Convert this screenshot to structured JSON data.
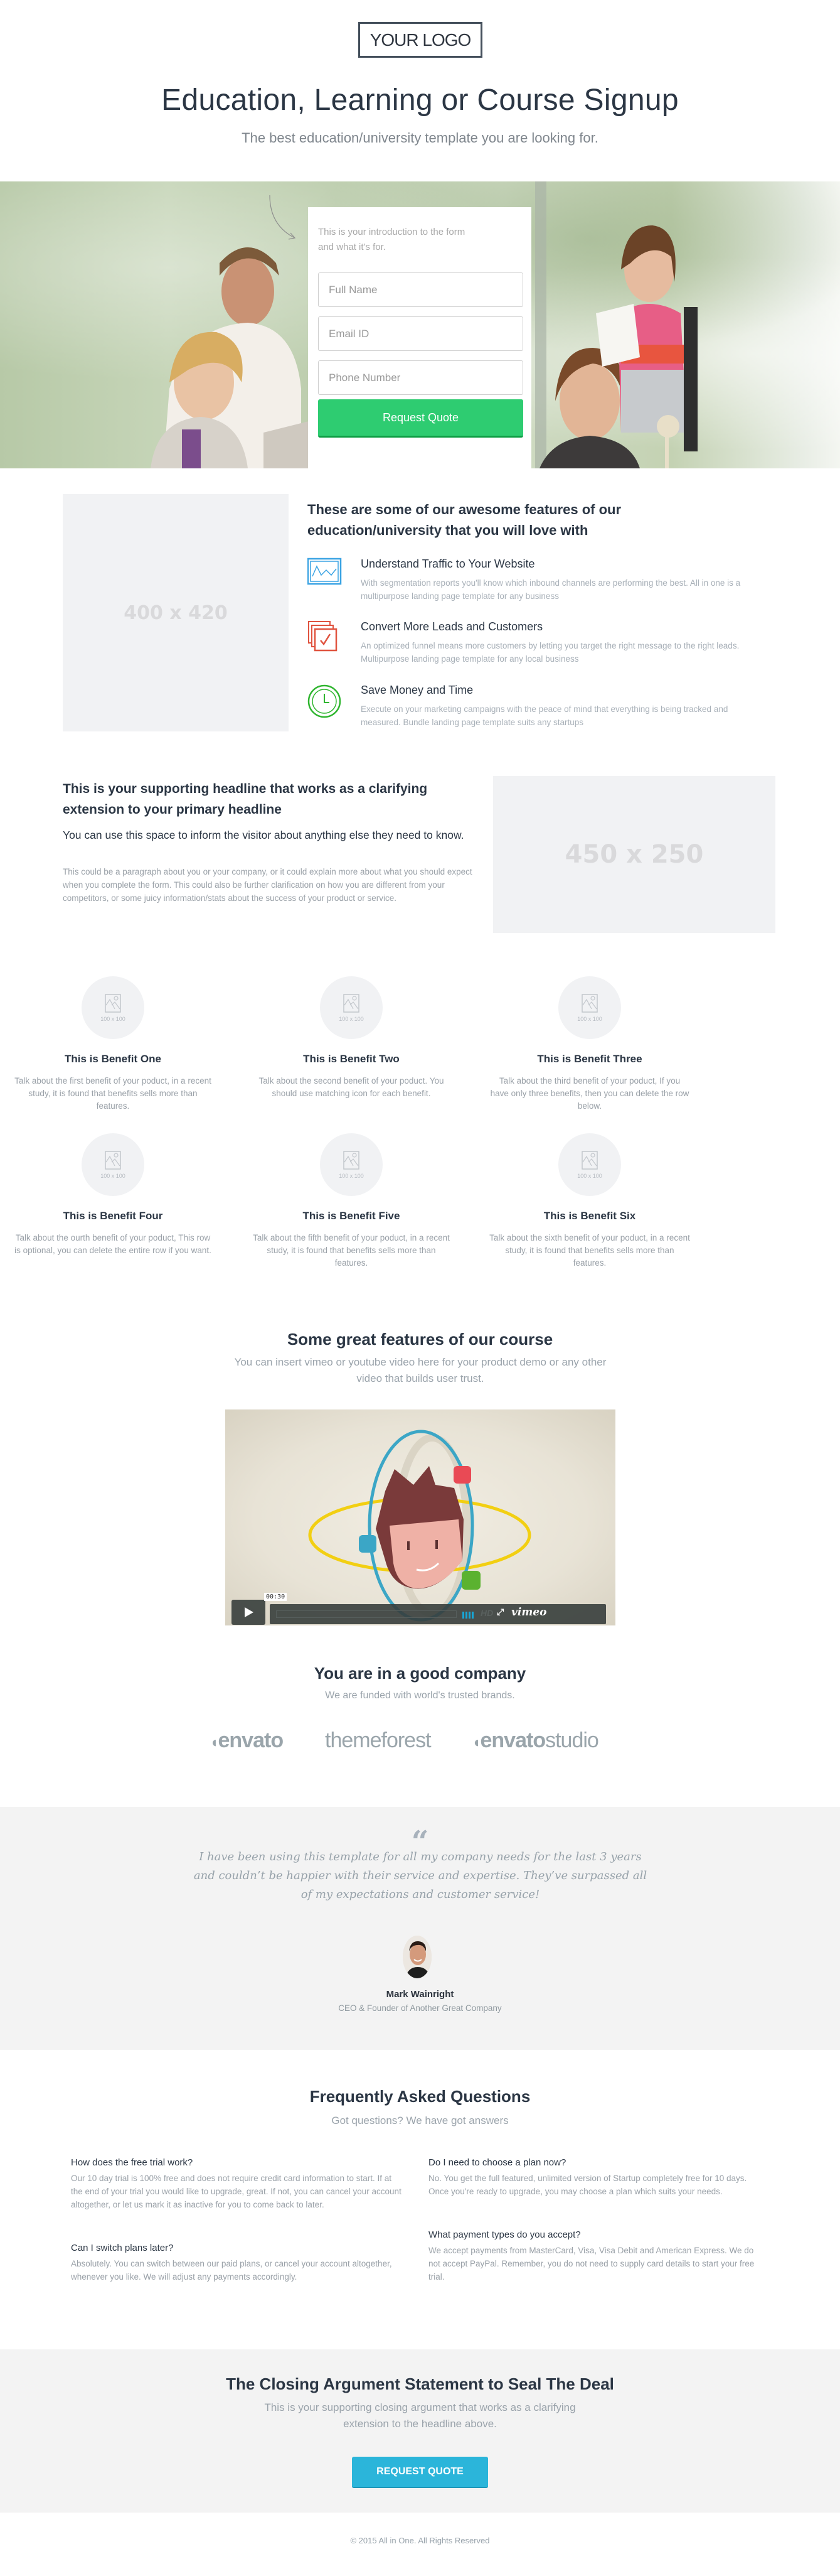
{
  "header": {
    "logo": "YOUR LOGO",
    "title": "Education, Learning or Course Signup",
    "subtitle": "The best education/university template you are looking for."
  },
  "hero_form": {
    "intro": "This is your introduction to the form and what it's for.",
    "fields": [
      {
        "placeholder": "Full Name",
        "value": ""
      },
      {
        "placeholder": "Email ID",
        "value": ""
      },
      {
        "placeholder": "Phone Number",
        "value": ""
      }
    ],
    "submit_label": "Request Quote",
    "colors": {
      "button": "#2ecc71"
    }
  },
  "features": {
    "image_placeholder": "400 x 420",
    "title": "These are some of our awesome features of our education/university that you will love with",
    "items": [
      {
        "icon": "chart-icon",
        "title": "Understand Traffic to Your Website",
        "description": "With segmentation reports you'll know which inbound channels are performing the best. All in one is a multipurpose landing page template for any business",
        "color": "#3aa3e3"
      },
      {
        "icon": "documents-check-icon",
        "title": "Convert More Leads and Customers",
        "description": "An optimized funnel means more customers by letting you target the right message to the right leads. Multipurpose landing page template for any local business",
        "color": "#e0533f"
      },
      {
        "icon": "clock-icon",
        "title": "Save Money and Time",
        "description": "Execute on your marketing campaigns with the peace of mind that everything is being tracked and measured. Bundle landing page template suits any startups",
        "color": "#2fb52f"
      }
    ]
  },
  "supporting": {
    "headline": "This is your supporting headline that works as a clarifying extension to your primary headline",
    "subheadline": "You can use this space to inform the visitor about anything else they need to know.",
    "body": "This could be a paragraph about you or your company, or it could explain more about what you should expect when you complete the form. This could also be further clarification on how you are different from your competitors, or some juicy information/stats about the success of your product or service.",
    "image_placeholder": "450 x 250"
  },
  "benefits": {
    "image_label": "100 x 100",
    "items": [
      {
        "title": "This is Benefit One",
        "description": "Talk about the first benefit of your poduct, in a recent study, it is found that benefits sells more than features."
      },
      {
        "title": "This is Benefit Two",
        "description": "Talk about the second benefit of your poduct. You should use matching icon for each benefit."
      },
      {
        "title": "This is Benefit Three",
        "description": "Talk about the third benefit of your poduct, If you have only three benefits, then you can delete the row below."
      },
      {
        "title": "This is Benefit Four",
        "description": "Talk about the ourth benefit of your poduct, This row is optional, you can delete the entire row if you want."
      },
      {
        "title": "This is Benefit Five",
        "description": "Talk about the fifth benefit of your poduct, in a recent study, it is found that benefits sells more than features."
      },
      {
        "title": "This is Benefit Six",
        "description": "Talk about the sixth benefit of your poduct, in a recent study, it is found that benefits sells more than features."
      }
    ]
  },
  "video": {
    "title": "Some great features of our course",
    "subtitle": "You can insert vimeo or youtube video here for your product demo or any other video that builds user trust.",
    "time": "00:30",
    "hd_label": "HD",
    "provider": "vimeo"
  },
  "brands": {
    "title": "You are in a good company",
    "subtitle": "We are funded with world's trusted brands.",
    "items": [
      "envato",
      "themeforest",
      "envato",
      "studio"
    ]
  },
  "testimonial": {
    "quote_mark": "“",
    "quote": "I have been using this template for all my company needs for the last 3 years and couldn’t be happier with their service and expertise. They’ve surpassed all of my expectations and customer service!",
    "name": "Mark Wainright",
    "role": "CEO & Founder of Another Great Company"
  },
  "faq": {
    "title": "Frequently Asked Questions",
    "subtitle": "Got questions? We have got answers",
    "items": [
      {
        "question": "How does the free trial work?",
        "answer": "Our 10 day trial is 100% free and does not require credit card information to start. If at the end of your trial you would like to upgrade, great. If not, you can cancel your account altogether, or let us mark it as inactive for you to come back to later."
      },
      {
        "question": "Do I need to choose a plan now?",
        "answer": "No. You get the full featured, unlimited version of Startup completely free for 10 days. Once you're ready to upgrade, you may choose a plan which suits your needs."
      },
      {
        "question": "Can I switch plans later?",
        "answer": "Absolutely. You can switch between our paid plans, or cancel your account altogether, whenever you like. We will adjust any payments accordingly."
      },
      {
        "question": "What payment types do you accept?",
        "answer": "We accept payments from MasterCard, Visa, Visa Debit and American Express. We do not accept PayPal. Remember, you do not need to supply card details to start your free trial."
      }
    ]
  },
  "closing": {
    "title": "The Closing Argument Statement to Seal The Deal",
    "subtitle": "This is your supporting closing argument that works as a clarifying extension to the headline above.",
    "button_label": "REQUEST QUOTE",
    "colors": {
      "button": "#2bb5da"
    }
  },
  "footer": {
    "copyright": "© 2015 All in One. All Rights Reserved"
  }
}
